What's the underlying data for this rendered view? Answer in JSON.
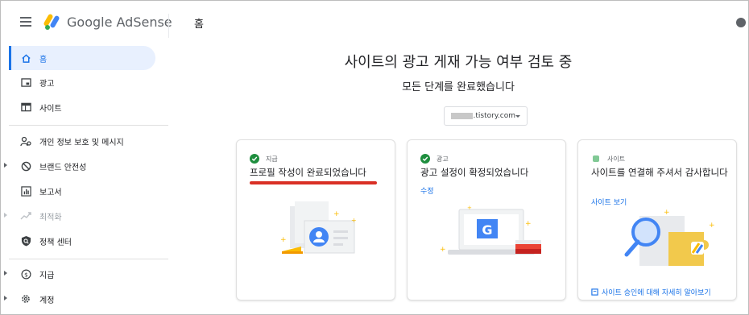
{
  "app": {
    "brand": "Google AdSense",
    "page_title": "홈"
  },
  "sidebar": {
    "items": [
      {
        "label": "홈",
        "icon": "home-icon",
        "active": true
      },
      {
        "label": "광고",
        "icon": "ads-icon"
      },
      {
        "label": "사이트",
        "icon": "sites-icon"
      },
      {
        "label": "개인 정보 보호 및 메시지",
        "icon": "privacy-icon"
      },
      {
        "label": "브랜드 안전성",
        "icon": "block-icon"
      },
      {
        "label": "보고서",
        "icon": "reports-icon"
      },
      {
        "label": "최적화",
        "icon": "optimization-icon",
        "disabled": true
      },
      {
        "label": "정책 센터",
        "icon": "policy-icon"
      },
      {
        "label": "지급",
        "icon": "payments-icon"
      },
      {
        "label": "계정",
        "icon": "account-gear-icon"
      }
    ]
  },
  "main": {
    "headline": "사이트의 광고 게재 가능 여부 검토 중",
    "subhead": "모든 단계를 완료했습니다",
    "site_select": {
      "value": ".tistory.com"
    },
    "cards": [
      {
        "step": "지급",
        "title": "프로필 작성이 완료되었습니다",
        "status": "complete"
      },
      {
        "step": "광고",
        "title": "광고 설정이 확정되었습니다",
        "link": "수정",
        "status": "complete"
      },
      {
        "step": "사이트",
        "title": "사이트를 연결해 주셔서 감사합니다",
        "link": "사이트 보기",
        "footer_link": "사이트 승인에 대해 자세히 알아보기",
        "status": "pending"
      }
    ]
  },
  "colors": {
    "accent": "#1a73e8",
    "success": "#1e8e3e",
    "highlight": "#d93025"
  }
}
